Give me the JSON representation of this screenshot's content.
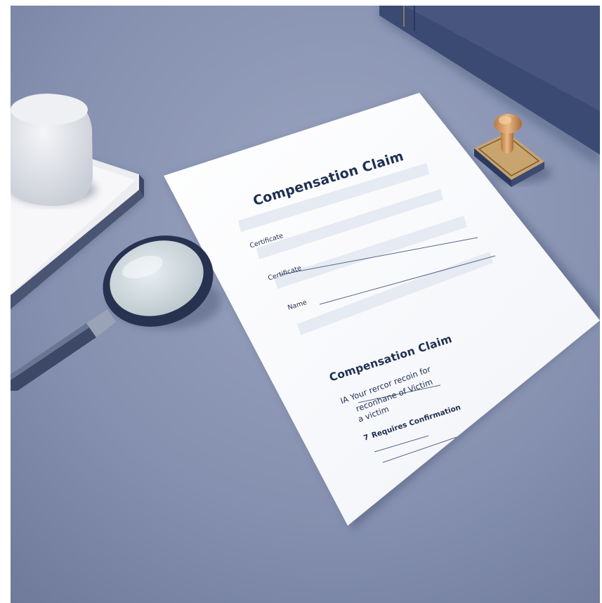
{
  "document": {
    "title": "Compensation Claim",
    "field_labels": [
      "Certificate",
      "Certificate",
      "Name"
    ],
    "section_title": "Compensation Claim",
    "body_lines": [
      "IA Your rercor recoin for",
      "reconhane of Victim",
      "a victim"
    ],
    "confirmation": "Requires Confirmation",
    "confirmation_prefix": "7"
  },
  "colors": {
    "desk": "#7f8bab",
    "paper": "#fbfcfe",
    "field": "#e6eaf3",
    "ink": "#1e2f52"
  }
}
